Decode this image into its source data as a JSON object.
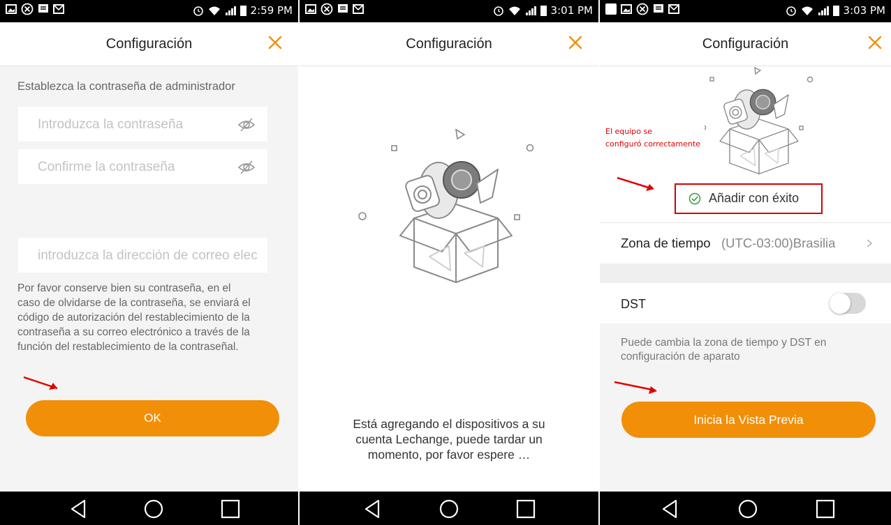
{
  "colors": {
    "accent": "#f18f09",
    "annotation_red": "#e00000",
    "success_green": "#3a9a3a"
  },
  "screen1": {
    "status": {
      "time": "2:59 PM",
      "left_icons": [
        "image-icon",
        "block-icon",
        "message-icon",
        "mail-icon"
      ],
      "right_icons": [
        "alarm-icon",
        "wifi-icon",
        "signal-icon",
        "battery-icon"
      ]
    },
    "title": "Configuración",
    "heading": "Establezca la contraseña de administrador",
    "password_placeholder": "Introduzca la contraseña",
    "confirm_placeholder": "Confirme la contraseña",
    "email_placeholder": "introduzca la dirección de correo elec",
    "note_lines": [
      "Por favor conserve bien su contraseña, en el",
      "caso de olvidarse de la contraseña, se enviará el",
      "código de autorización del restablecimiento de la",
      "contraseña a su correo electrónico a través de la",
      "función del restablecimiento de la contraseñal."
    ],
    "ok_label": "OK"
  },
  "screen2": {
    "status": {
      "time": "3:01 PM"
    },
    "title": "Configuración",
    "message_lines": [
      "Está agregando el dispositivos a su",
      "cuenta Lechange, puede tardar un",
      "momento, por favor espere …"
    ]
  },
  "screen3": {
    "status": {
      "time": "3:03 PM"
    },
    "title": "Configuración",
    "annotation_lines": [
      "El equipo se",
      "configuró correctamente"
    ],
    "success_text": "Añadir con éxito",
    "timezone_label": "Zona de tiempo",
    "timezone_value": "(UTC-03:00)Brasilia",
    "dst_label": "DST",
    "dst_enabled": false,
    "hint_lines": [
      "Puede cambia la zona de tiempo y DST en",
      "configuración de aparato"
    ],
    "preview_label": "Inicia la Vista Previa"
  }
}
